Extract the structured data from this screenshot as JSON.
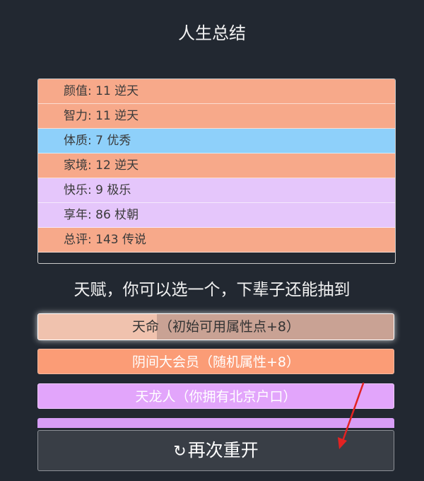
{
  "page": {
    "title": "人生总结"
  },
  "summary": {
    "rows": [
      {
        "label": "颜值: 11 逆天"
      },
      {
        "label": "智力: 11 逆天"
      },
      {
        "label": "体质: 7 优秀"
      },
      {
        "label": "家境: 12 逆天"
      },
      {
        "label": "快乐: 9 极乐"
      },
      {
        "label": "享年: 86 杖朝"
      },
      {
        "label": "总评: 143 传说"
      }
    ]
  },
  "talents": {
    "heading": "天赋，你可以选一个，下辈子还能抽到",
    "items": [
      {
        "label": "天命（初始可用属性点+8）"
      },
      {
        "label": "阴间大会员（随机属性+8）"
      },
      {
        "label": "天龙人（你拥有北京户口）"
      }
    ]
  },
  "restart": {
    "icon": "refresh-icon",
    "label": "再次重开"
  },
  "colors": {
    "background": "#222831",
    "orange": "#f7a98a",
    "blue": "#8ed0fa",
    "purple": "#e5c6fb",
    "talent_orange": "#fb9c76",
    "talent_purple": "#e2a5fb",
    "button": "#393e46",
    "annotation_arrow": "#e32222"
  }
}
